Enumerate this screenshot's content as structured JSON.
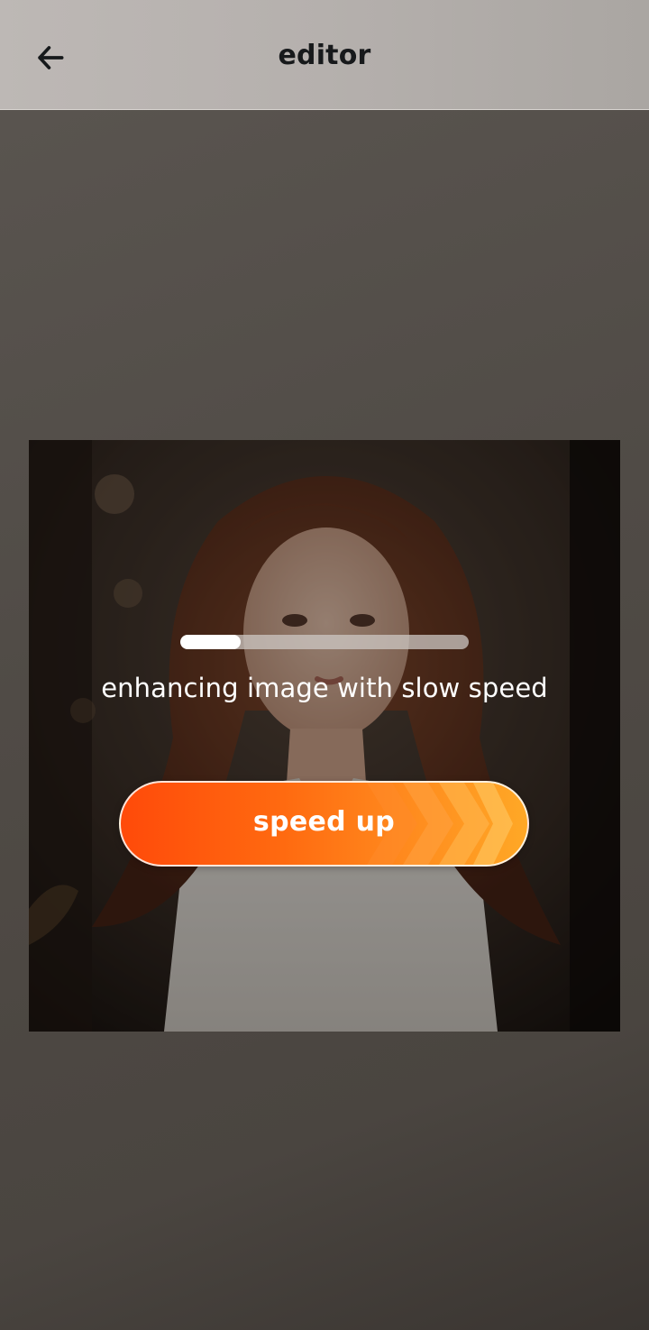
{
  "header": {
    "title": "editor",
    "back_icon": "arrow-left-icon"
  },
  "preview": {
    "progress_fraction": 0.21,
    "status_text": "enhancing image with slow speed",
    "speed_up_label": "speed up",
    "speed_up_icon": "chevrons-right-icon"
  },
  "colors": {
    "accent_start": "#ff4a0a",
    "accent_end": "#ffa826",
    "header_bg": "#b5b0ad",
    "page_bg": "#504b46"
  }
}
